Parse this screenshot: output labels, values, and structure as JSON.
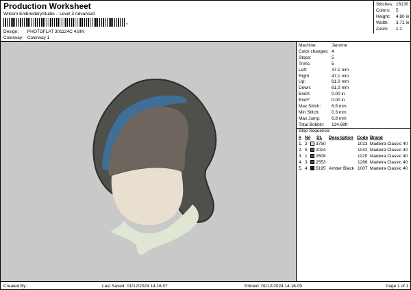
{
  "header": {
    "title": "Production Worksheet",
    "subtitle": "Wilcom EmbroideryStudio – Level 3 Advanced",
    "barcode_tail": ",",
    "design_label": "Design:",
    "design_value": "PHOTOFLAT 301124C 4,8IN",
    "colorway_label": "Colorway:",
    "colorway_value": "Colorway 1"
  },
  "stats": [
    {
      "label": "Stitches:",
      "value": "16130"
    },
    {
      "label": "Colors:",
      "value": "5"
    },
    {
      "label": "Height:",
      "value": "4.80 in"
    },
    {
      "label": "Width:",
      "value": "3.71 in"
    },
    {
      "label": "Zoom:",
      "value": "1:1"
    }
  ],
  "machine_info": [
    {
      "label": "Machine:",
      "value": "Janome"
    },
    {
      "label": "Color changes:",
      "value": "4"
    },
    {
      "label": "Stops:",
      "value": "5"
    },
    {
      "label": "Trims:",
      "value": "5"
    },
    {
      "label": "Left:",
      "value": "47.1 mm"
    },
    {
      "label": "Right:",
      "value": "47.1 mm"
    },
    {
      "label": "Up:",
      "value": "61.0 mm"
    },
    {
      "label": "Down:",
      "value": "61.0 mm"
    },
    {
      "label": "EndX:",
      "value": "0.00 in"
    },
    {
      "label": "EndY:",
      "value": "0.00 in"
    },
    {
      "label": "Max Stitch:",
      "value": "6.5 mm"
    },
    {
      "label": "Min Stitch:",
      "value": "0.3 mm"
    },
    {
      "label": "Max Jump:",
      "value": "6.8 mm"
    },
    {
      "label": "Total Bobbin:",
      "value": "134.69ft"
    }
  ],
  "stop_sequence": {
    "title": "Stop Sequence:",
    "headers": {
      "num": "#",
      "n": "N#",
      "st": "St.",
      "desc": "Description",
      "code": "Code",
      "brand": "Brand"
    },
    "rows": [
      {
        "num": "1.",
        "n": "2",
        "color": "#e8dcc8",
        "st": "3750",
        "desc": "",
        "code": "1013",
        "brand": "Madeira Classic 40"
      },
      {
        "num": "2.",
        "n": "5",
        "color": "#2e5a86",
        "st": "2024",
        "desc": "",
        "code": "1042",
        "brand": "Madeira Classic 40"
      },
      {
        "num": "3.",
        "n": "1",
        "color": "#5a5650",
        "st": "2608",
        "desc": "",
        "code": "1129",
        "brand": "Madeira Classic 40"
      },
      {
        "num": "4.",
        "n": "3",
        "color": "#4a4a48",
        "st": "2553",
        "desc": "",
        "code": "1286",
        "brand": "Madeira Classic 40"
      },
      {
        "num": "5.",
        "n": "4",
        "color": "#1e1e1e",
        "st": "5195",
        "desc": "Amber Black",
        "code": "1007",
        "brand": "Madeira Classic 40"
      }
    ]
  },
  "footer": {
    "created_by": "Created By:",
    "last_saved": "Last Saved: 01/12/2024 14.16.07",
    "printed": "Printed: 01/12/2024 14.16.09",
    "page": "Page 1 of 1"
  },
  "design_colors": {
    "hair": "#4f4f4c",
    "hair_outline": "#2c2c2a",
    "hat": "#6e665e",
    "band": "#3f6f96",
    "face": "#e9dfcf",
    "scarf": "#dfe6d4",
    "canvas": "#c9c9c9"
  }
}
